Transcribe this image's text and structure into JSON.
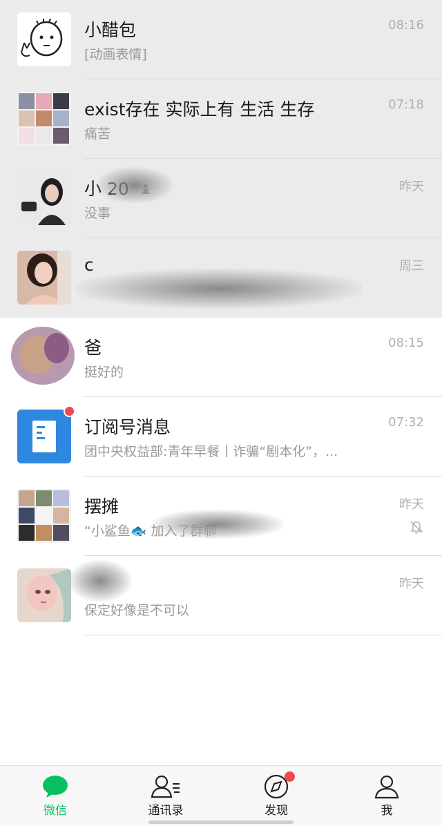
{
  "chats": [
    {
      "name": "小醋包",
      "preview": "[动画表情]",
      "time": "08:16"
    },
    {
      "name": "exist存在 实际上有 生活 生存",
      "preview": "痛苦",
      "time": "07:18"
    },
    {
      "name": "小        20",
      "preview": "没事",
      "time": "昨天"
    },
    {
      "name": "c",
      "preview": "",
      "time": "周三"
    },
    {
      "name": "爸",
      "preview": "挺好的",
      "time": "08:15"
    },
    {
      "name": "订阅号消息",
      "preview": "团中央权益部:青年早餐丨诈骗“剧本化”，...",
      "time": "07:32"
    },
    {
      "name": "摆摊",
      "preview": "“小鲨鱼🐟            加入了群聊",
      "time": "昨天"
    },
    {
      "name": "",
      "preview": "保定好像是不可以",
      "time": "昨天"
    }
  ],
  "tabs": [
    {
      "label": "微信",
      "icon": "chat-bubble-icon"
    },
    {
      "label": "通讯录",
      "icon": "contacts-icon"
    },
    {
      "label": "发现",
      "icon": "compass-icon"
    },
    {
      "label": "我",
      "icon": "person-icon"
    }
  ],
  "colors": {
    "accent": "#07c160",
    "badge": "#f0484c",
    "pinned_bg": "#ebebeb",
    "subscription_blue": "#2f88e0"
  }
}
